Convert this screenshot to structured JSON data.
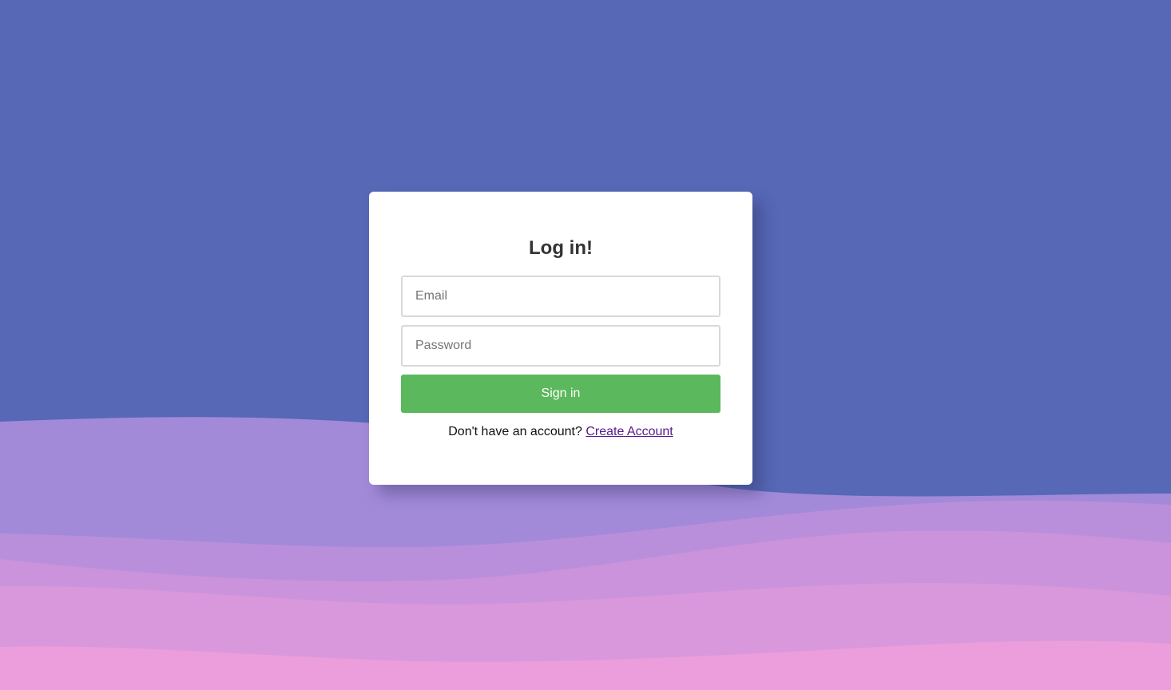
{
  "login": {
    "title": "Log in!",
    "email_placeholder": "Email",
    "password_placeholder": "Password",
    "signin_label": "Sign in",
    "no_account_text": "Don't have an account?",
    "create_account_label": "Create Account"
  },
  "colors": {
    "background": "#5668b6",
    "wave_1": "#a28ad9",
    "wave_2": "#b98fdb",
    "wave_3": "#cb93db",
    "wave_4": "#d998db",
    "wave_5": "#eb9edb",
    "signin_button": "#5cb85c",
    "link": "#551a8b"
  }
}
